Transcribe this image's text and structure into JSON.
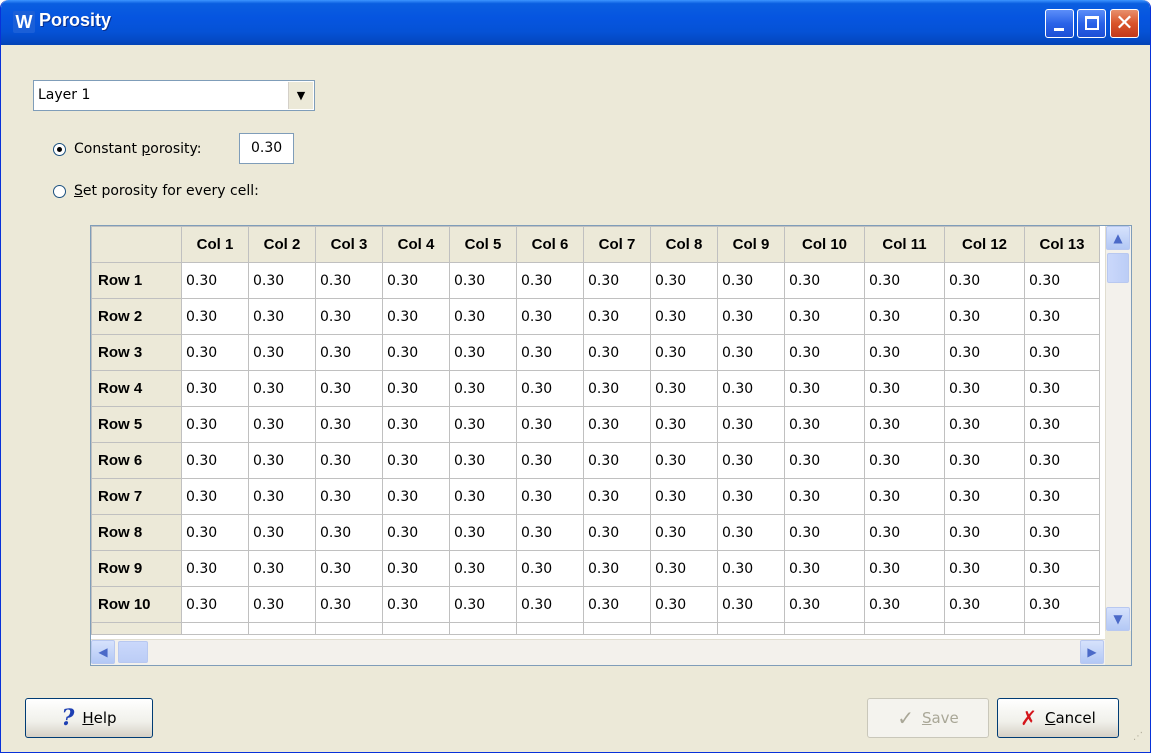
{
  "window": {
    "title": "Porosity",
    "app_icon": "W"
  },
  "layer_select": {
    "value": "Layer 1"
  },
  "options": {
    "constant_label_pre": "Constant ",
    "constant_label_accel": "p",
    "constant_label_post": "orosity:",
    "constant_value": "0.30",
    "set_label_accel": "S",
    "set_label_post": "et porosity for every cell:",
    "selected": "constant"
  },
  "grid": {
    "columns": [
      "Col 1",
      "Col 2",
      "Col 3",
      "Col 4",
      "Col 5",
      "Col 6",
      "Col 7",
      "Col 8",
      "Col 9",
      "Col 10",
      "Col 11",
      "Col 12",
      "Col 13"
    ],
    "rows": [
      {
        "label": "Row 1",
        "values": [
          "0.30",
          "0.30",
          "0.30",
          "0.30",
          "0.30",
          "0.30",
          "0.30",
          "0.30",
          "0.30",
          "0.30",
          "0.30",
          "0.30",
          "0.30"
        ]
      },
      {
        "label": "Row 2",
        "values": [
          "0.30",
          "0.30",
          "0.30",
          "0.30",
          "0.30",
          "0.30",
          "0.30",
          "0.30",
          "0.30",
          "0.30",
          "0.30",
          "0.30",
          "0.30"
        ]
      },
      {
        "label": "Row 3",
        "values": [
          "0.30",
          "0.30",
          "0.30",
          "0.30",
          "0.30",
          "0.30",
          "0.30",
          "0.30",
          "0.30",
          "0.30",
          "0.30",
          "0.30",
          "0.30"
        ]
      },
      {
        "label": "Row 4",
        "values": [
          "0.30",
          "0.30",
          "0.30",
          "0.30",
          "0.30",
          "0.30",
          "0.30",
          "0.30",
          "0.30",
          "0.30",
          "0.30",
          "0.30",
          "0.30"
        ]
      },
      {
        "label": "Row 5",
        "values": [
          "0.30",
          "0.30",
          "0.30",
          "0.30",
          "0.30",
          "0.30",
          "0.30",
          "0.30",
          "0.30",
          "0.30",
          "0.30",
          "0.30",
          "0.30"
        ]
      },
      {
        "label": "Row 6",
        "values": [
          "0.30",
          "0.30",
          "0.30",
          "0.30",
          "0.30",
          "0.30",
          "0.30",
          "0.30",
          "0.30",
          "0.30",
          "0.30",
          "0.30",
          "0.30"
        ]
      },
      {
        "label": "Row 7",
        "values": [
          "0.30",
          "0.30",
          "0.30",
          "0.30",
          "0.30",
          "0.30",
          "0.30",
          "0.30",
          "0.30",
          "0.30",
          "0.30",
          "0.30",
          "0.30"
        ]
      },
      {
        "label": "Row 8",
        "values": [
          "0.30",
          "0.30",
          "0.30",
          "0.30",
          "0.30",
          "0.30",
          "0.30",
          "0.30",
          "0.30",
          "0.30",
          "0.30",
          "0.30",
          "0.30"
        ]
      },
      {
        "label": "Row 9",
        "values": [
          "0.30",
          "0.30",
          "0.30",
          "0.30",
          "0.30",
          "0.30",
          "0.30",
          "0.30",
          "0.30",
          "0.30",
          "0.30",
          "0.30",
          "0.30"
        ]
      },
      {
        "label": "Row 10",
        "values": [
          "0.30",
          "0.30",
          "0.30",
          "0.30",
          "0.30",
          "0.30",
          "0.30",
          "0.30",
          "0.30",
          "0.30",
          "0.30",
          "0.30",
          "0.30"
        ]
      }
    ]
  },
  "buttons": {
    "help_accel": "H",
    "help_post": "elp",
    "save_accel": "S",
    "save_post": "ave",
    "save_enabled": false,
    "cancel_accel": "C",
    "cancel_post": "ancel"
  },
  "icons": {
    "help": "question-mark-icon",
    "save": "checkmark-icon",
    "cancel": "x-icon",
    "minimize": "minimize-icon",
    "maximize": "maximize-icon",
    "close": "close-icon"
  },
  "colors": {
    "titlebar": "#0a5ee0",
    "window_bg": "#ece9d8",
    "cancel_icon": "#d4151b"
  }
}
